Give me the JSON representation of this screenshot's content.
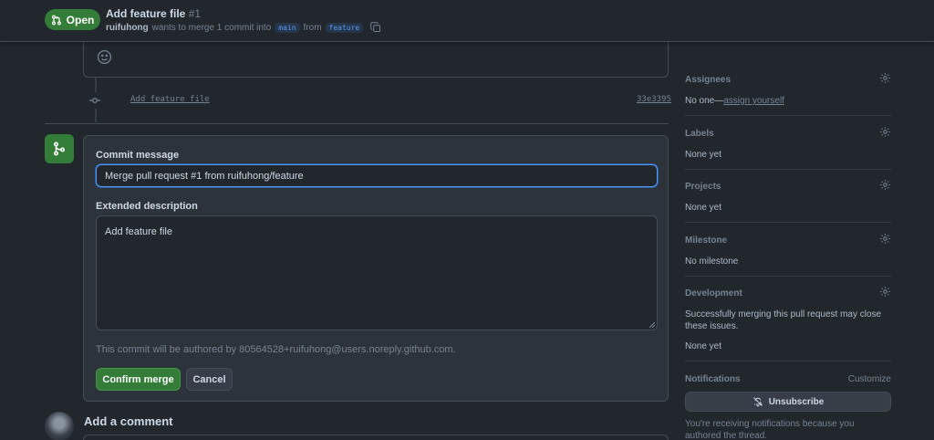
{
  "header": {
    "state": "Open",
    "title": "Add feature file",
    "number": "#1",
    "author": "ruifuhong",
    "merge_text": "wants to merge 1 commit into",
    "base_branch": "main",
    "from_text": "from",
    "head_branch": "feature"
  },
  "timeline": {
    "commit_message": "Add feature file",
    "commit_sha": "33e3395"
  },
  "merge_form": {
    "commit_message_label": "Commit message",
    "commit_message_value": "Merge pull request #1 from ruifuhong/feature",
    "extended_description_label": "Extended description",
    "extended_description_value": "Add feature file",
    "author_note": "This commit will be authored by 80564528+ruifuhong@users.noreply.github.com.",
    "confirm_label": "Confirm merge",
    "cancel_label": "Cancel"
  },
  "comment": {
    "title": "Add a comment"
  },
  "sidebar": {
    "assignees": {
      "title": "Assignees",
      "value_prefix": "No one—",
      "value_link": "assign yourself"
    },
    "labels": {
      "title": "Labels",
      "value": "None yet"
    },
    "projects": {
      "title": "Projects",
      "value": "None yet"
    },
    "milestone": {
      "title": "Milestone",
      "value": "No milestone"
    },
    "development": {
      "title": "Development",
      "description": "Successfully merging this pull request may close these issues.",
      "value": "None yet"
    },
    "notifications": {
      "title": "Notifications",
      "customize": "Customize",
      "unsubscribe_label": "Unsubscribe",
      "note": "You're receiving notifications because you authored the thread."
    }
  },
  "colors": {
    "background": "#22272e",
    "surface": "#2d333b",
    "border": "#444c56",
    "success": "#347d39",
    "accent": "#539bf5",
    "muted_text": "#768390"
  }
}
